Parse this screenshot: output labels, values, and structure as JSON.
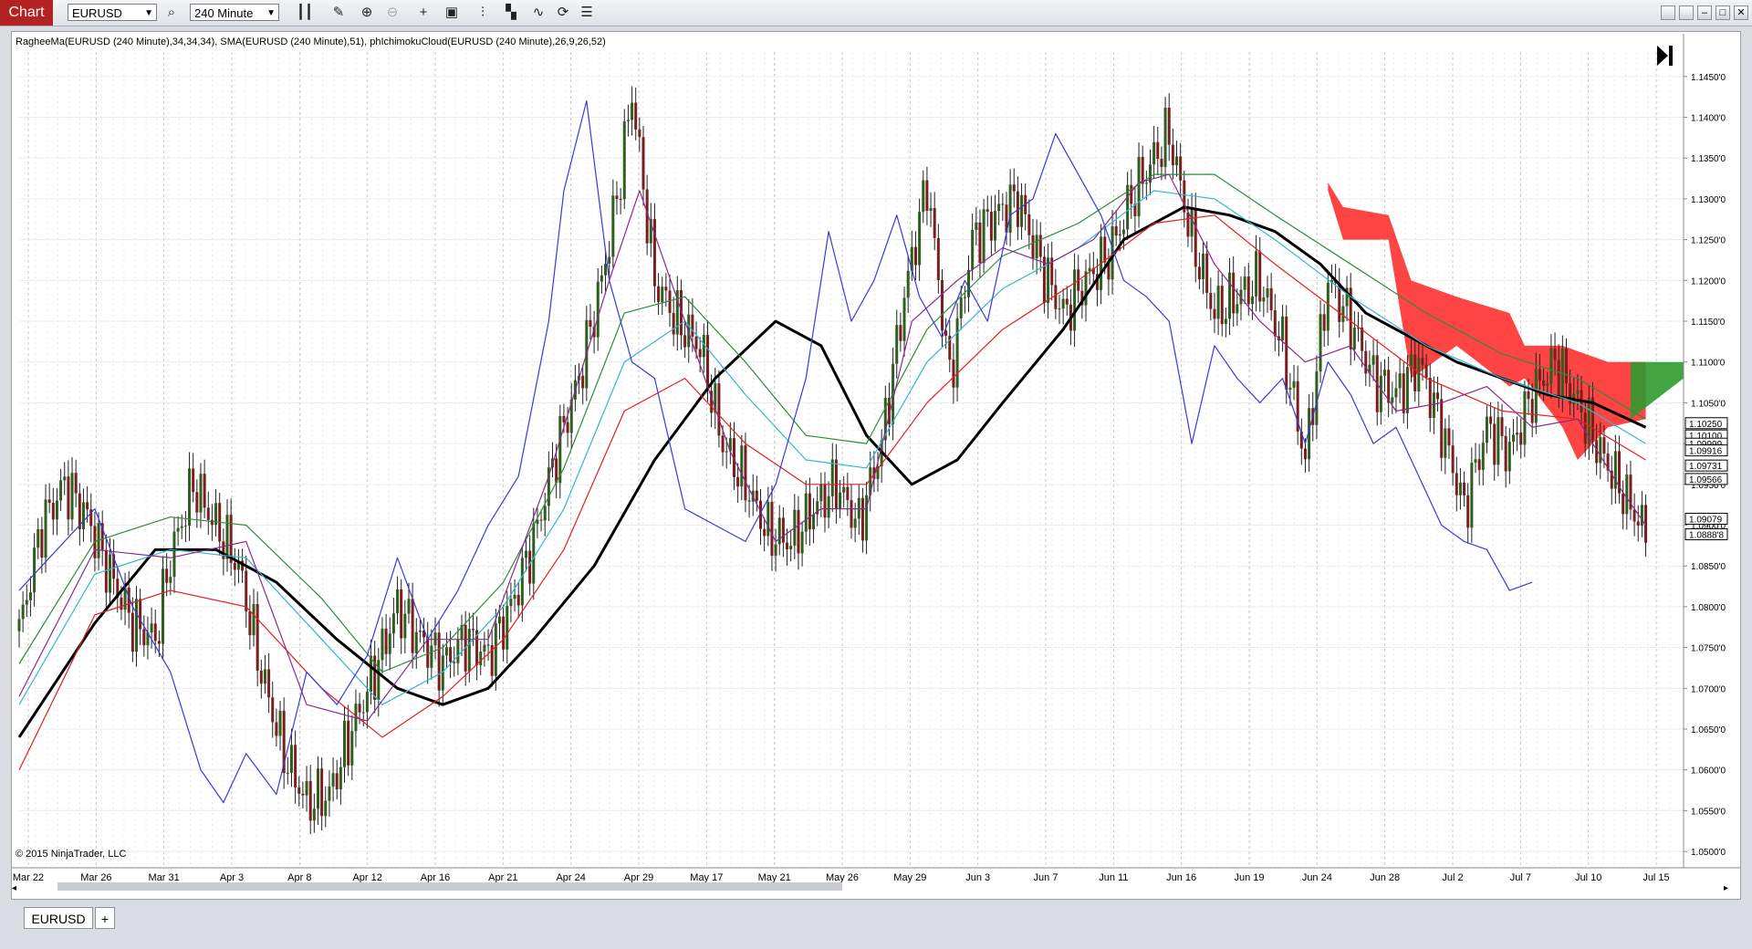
{
  "app": {
    "chart_tab": "Chart"
  },
  "toolbar": {
    "instrument": "EURUSD",
    "interval": "240 Minute",
    "icons": [
      "search-icon",
      "bar-type-icon",
      "draw-pencil-icon",
      "zoom-in-icon",
      "zoom-out-icon",
      "crosshair-icon",
      "data-box-icon",
      "indicators-icon",
      "strategies-icon",
      "chart-style-icon",
      "refresh-icon",
      "properties-icon"
    ]
  },
  "window": {
    "buttons": [
      "restore-icon",
      "tile-icon",
      "minimize-icon",
      "maximize-icon",
      "close-icon"
    ]
  },
  "chart": {
    "indicator_label": "RagheeMa(EURUSD (240 Minute),34,34,34), SMA(EURUSD (240 Minute),51), phIchimokuCloud(EURUSD (240 Minute),26,9,26,52)",
    "copyright": "© 2015 NinjaTrader, LLC",
    "colors": {
      "up_candle": "#2e5f1f",
      "down_candle": "#7a1f1f",
      "sma": "#000000",
      "ragheema_lower": "#e02020",
      "ragheema_mid": "#30b8d0",
      "ragheema_upper": "#2e8b3e",
      "ichimoku_line": "#3a3ad8",
      "ichimoku_purple": "#8b2a8b",
      "cloud_bear": "#ff3030",
      "cloud_bull": "#2e9b2e"
    }
  },
  "chart_data": {
    "type": "candlestick",
    "instrument": "EURUSD",
    "interval": "240 Minute",
    "x_labels": [
      "Mar 22",
      "Mar 26",
      "Mar 31",
      "Apr 3",
      "Apr 8",
      "Apr 12",
      "Apr 16",
      "Apr 21",
      "Apr 24",
      "Apr 29",
      "May 17",
      "May 21",
      "May 26",
      "May 29",
      "Jun 3",
      "Jun 7",
      "Jun 11",
      "Jun 16",
      "Jun 19",
      "Jun 24",
      "Jun 28",
      "Jul 2",
      "Jul 7",
      "Jul 10",
      "Jul 15"
    ],
    "y_ticks": [
      "1.0500'0",
      "1.0550'0",
      "1.0600'0",
      "1.0650'0",
      "1.0700'0",
      "1.0750'0",
      "1.0800'0",
      "1.0850'0",
      "1.0900'0",
      "1.0950'0",
      "1.1000'0",
      "1.1050'0",
      "1.1100'0",
      "1.1150'0",
      "1.1200'0",
      "1.1250'0",
      "1.1300'0",
      "1.1350'0",
      "1.1400'0",
      "1.1450'0"
    ],
    "ylim": [
      1.048,
      1.148
    ],
    "price_markers": [
      "1.10250",
      "1.10100",
      "1.09999",
      "1.09916",
      "1.09731",
      "1.09566",
      "1.09079",
      "1.0888'8"
    ],
    "close_path": [
      [
        0,
        1.077
      ],
      [
        3,
        1.09
      ],
      [
        6,
        1.095
      ],
      [
        9,
        1.091
      ],
      [
        12,
        1.084
      ],
      [
        15,
        1.078
      ],
      [
        18,
        1.076
      ],
      [
        20,
        1.086
      ],
      [
        23,
        1.095
      ],
      [
        26,
        1.09
      ],
      [
        29,
        1.085
      ],
      [
        32,
        1.072
      ],
      [
        35,
        1.062
      ],
      [
        38,
        1.056
      ],
      [
        41,
        1.057
      ],
      [
        44,
        1.065
      ],
      [
        47,
        1.072
      ],
      [
        50,
        1.08
      ],
      [
        53,
        1.076
      ],
      [
        56,
        1.073
      ],
      [
        59,
        1.076
      ],
      [
        62,
        1.074
      ],
      [
        65,
        1.08
      ],
      [
        68,
        1.088
      ],
      [
        71,
        1.099
      ],
      [
        74,
        1.108
      ],
      [
        77,
        1.12
      ],
      [
        79,
        1.13
      ],
      [
        81,
        1.143
      ],
      [
        84,
        1.12
      ],
      [
        87,
        1.115
      ],
      [
        90,
        1.112
      ],
      [
        93,
        1.1
      ],
      [
        96,
        1.095
      ],
      [
        99,
        1.089
      ],
      [
        102,
        1.088
      ],
      [
        105,
        1.092
      ],
      [
        108,
        1.095
      ],
      [
        111,
        1.09
      ],
      [
        114,
        1.1
      ],
      [
        117,
        1.118
      ],
      [
        120,
        1.132
      ],
      [
        123,
        1.108
      ],
      [
        126,
        1.125
      ],
      [
        129,
        1.128
      ],
      [
        132,
        1.13
      ],
      [
        135,
        1.122
      ],
      [
        138,
        1.116
      ],
      [
        141,
        1.12
      ],
      [
        144,
        1.123
      ],
      [
        147,
        1.13
      ],
      [
        150,
        1.135
      ],
      [
        152,
        1.138
      ],
      [
        155,
        1.125
      ],
      [
        158,
        1.116
      ],
      [
        161,
        1.118
      ],
      [
        164,
        1.12
      ],
      [
        167,
        1.112
      ],
      [
        170,
        1.098
      ],
      [
        173,
        1.12
      ],
      [
        176,
        1.115
      ],
      [
        179,
        1.108
      ],
      [
        182,
        1.106
      ],
      [
        185,
        1.11
      ],
      [
        188,
        1.102
      ],
      [
        191,
        1.092
      ],
      [
        194,
        1.102
      ],
      [
        197,
        1.099
      ],
      [
        200,
        1.106
      ],
      [
        203,
        1.11
      ],
      [
        206,
        1.105
      ],
      [
        209,
        1.099
      ],
      [
        212,
        1.094
      ],
      [
        215,
        1.089
      ]
    ],
    "series": [
      {
        "name": "SMA(EURUSD (240 Minute),51)",
        "color": "#000000",
        "points": [
          [
            0,
            1.064
          ],
          [
            10,
            1.078
          ],
          [
            18,
            1.087
          ],
          [
            26,
            1.087
          ],
          [
            34,
            1.083
          ],
          [
            42,
            1.076
          ],
          [
            50,
            1.07
          ],
          [
            56,
            1.068
          ],
          [
            62,
            1.07
          ],
          [
            68,
            1.076
          ],
          [
            76,
            1.085
          ],
          [
            84,
            1.098
          ],
          [
            92,
            1.108
          ],
          [
            100,
            1.115
          ],
          [
            106,
            1.112
          ],
          [
            112,
            1.101
          ],
          [
            118,
            1.095
          ],
          [
            124,
            1.098
          ],
          [
            130,
            1.105
          ],
          [
            138,
            1.114
          ],
          [
            146,
            1.125
          ],
          [
            154,
            1.129
          ],
          [
            160,
            1.128
          ],
          [
            166,
            1.126
          ],
          [
            172,
            1.122
          ],
          [
            178,
            1.116
          ],
          [
            184,
            1.113
          ],
          [
            190,
            1.11
          ],
          [
            196,
            1.108
          ],
          [
            202,
            1.106
          ],
          [
            208,
            1.105
          ],
          [
            215,
            1.102
          ]
        ]
      },
      {
        "name": "RagheeMa lower",
        "color": "#e02020",
        "points": [
          [
            0,
            1.06
          ],
          [
            10,
            1.079
          ],
          [
            20,
            1.082
          ],
          [
            30,
            1.08
          ],
          [
            40,
            1.07
          ],
          [
            48,
            1.064
          ],
          [
            56,
            1.069
          ],
          [
            64,
            1.076
          ],
          [
            72,
            1.087
          ],
          [
            80,
            1.104
          ],
          [
            88,
            1.108
          ],
          [
            96,
            1.1
          ],
          [
            104,
            1.095
          ],
          [
            112,
            1.095
          ],
          [
            120,
            1.105
          ],
          [
            130,
            1.114
          ],
          [
            140,
            1.12
          ],
          [
            150,
            1.127
          ],
          [
            158,
            1.128
          ],
          [
            166,
            1.122
          ],
          [
            176,
            1.115
          ],
          [
            186,
            1.108
          ],
          [
            196,
            1.104
          ],
          [
            206,
            1.103
          ],
          [
            215,
            1.098
          ]
        ]
      },
      {
        "name": "RagheeMa mid",
        "color": "#30b8d0",
        "points": [
          [
            0,
            1.068
          ],
          [
            10,
            1.084
          ],
          [
            20,
            1.087
          ],
          [
            30,
            1.086
          ],
          [
            40,
            1.076
          ],
          [
            48,
            1.068
          ],
          [
            56,
            1.072
          ],
          [
            64,
            1.08
          ],
          [
            72,
            1.092
          ],
          [
            80,
            1.11
          ],
          [
            88,
            1.115
          ],
          [
            96,
            1.106
          ],
          [
            104,
            1.098
          ],
          [
            112,
            1.097
          ],
          [
            120,
            1.11
          ],
          [
            130,
            1.119
          ],
          [
            140,
            1.124
          ],
          [
            150,
            1.131
          ],
          [
            158,
            1.13
          ],
          [
            166,
            1.125
          ],
          [
            176,
            1.118
          ],
          [
            186,
            1.112
          ],
          [
            196,
            1.108
          ],
          [
            206,
            1.105
          ],
          [
            215,
            1.1
          ]
        ]
      },
      {
        "name": "RagheeMa upper",
        "color": "#2e8b3e",
        "points": [
          [
            0,
            1.073
          ],
          [
            10,
            1.088
          ],
          [
            20,
            1.091
          ],
          [
            30,
            1.09
          ],
          [
            40,
            1.081
          ],
          [
            48,
            1.072
          ],
          [
            56,
            1.075
          ],
          [
            64,
            1.083
          ],
          [
            72,
            1.097
          ],
          [
            80,
            1.116
          ],
          [
            88,
            1.118
          ],
          [
            96,
            1.11
          ],
          [
            104,
            1.101
          ],
          [
            112,
            1.1
          ],
          [
            120,
            1.114
          ],
          [
            130,
            1.123
          ],
          [
            140,
            1.127
          ],
          [
            150,
            1.133
          ],
          [
            158,
            1.133
          ],
          [
            166,
            1.128
          ],
          [
            176,
            1.122
          ],
          [
            186,
            1.116
          ],
          [
            196,
            1.111
          ],
          [
            206,
            1.108
          ],
          [
            215,
            1.103
          ]
        ]
      },
      {
        "name": "Ichimoku lagging",
        "color": "#3a3ad8",
        "points": [
          [
            0,
            1.082
          ],
          [
            5,
            1.087
          ],
          [
            10,
            1.092
          ],
          [
            15,
            1.08
          ],
          [
            20,
            1.072
          ],
          [
            24,
            1.06
          ],
          [
            27,
            1.056
          ],
          [
            30,
            1.062
          ],
          [
            34,
            1.057
          ],
          [
            38,
            1.072
          ],
          [
            42,
            1.068
          ],
          [
            46,
            1.074
          ],
          [
            50,
            1.086
          ],
          [
            54,
            1.076
          ],
          [
            58,
            1.082
          ],
          [
            62,
            1.09
          ],
          [
            66,
            1.096
          ],
          [
            70,
            1.115
          ],
          [
            72,
            1.131
          ],
          [
            75,
            1.142
          ],
          [
            78,
            1.12
          ],
          [
            81,
            1.11
          ],
          [
            84,
            1.108
          ],
          [
            88,
            1.092
          ],
          [
            92,
            1.09
          ],
          [
            96,
            1.088
          ],
          [
            100,
            1.095
          ],
          [
            104,
            1.108
          ],
          [
            107,
            1.126
          ],
          [
            110,
            1.115
          ],
          [
            113,
            1.12
          ],
          [
            116,
            1.128
          ],
          [
            119,
            1.118
          ],
          [
            122,
            1.113
          ],
          [
            125,
            1.12
          ],
          [
            128,
            1.115
          ],
          [
            131,
            1.128
          ],
          [
            134,
            1.13
          ],
          [
            137,
            1.138
          ],
          [
            140,
            1.133
          ],
          [
            143,
            1.128
          ],
          [
            146,
            1.12
          ],
          [
            149,
            1.118
          ],
          [
            152,
            1.115
          ],
          [
            155,
            1.1
          ],
          [
            158,
            1.112
          ],
          [
            161,
            1.108
          ],
          [
            164,
            1.105
          ],
          [
            167,
            1.108
          ],
          [
            170,
            1.1
          ],
          [
            173,
            1.11
          ],
          [
            176,
            1.106
          ],
          [
            179,
            1.1
          ],
          [
            182,
            1.102
          ],
          [
            185,
            1.096
          ],
          [
            188,
            1.09
          ],
          [
            191,
            1.088
          ],
          [
            194,
            1.087
          ],
          [
            197,
            1.082
          ],
          [
            200,
            1.083
          ]
        ]
      },
      {
        "name": "Ichimoku purple",
        "color": "#8b2a8b",
        "points": [
          [
            0,
            1.069
          ],
          [
            10,
            1.087
          ],
          [
            20,
            1.086
          ],
          [
            30,
            1.088
          ],
          [
            38,
            1.068
          ],
          [
            46,
            1.066
          ],
          [
            54,
            1.076
          ],
          [
            62,
            1.076
          ],
          [
            70,
            1.096
          ],
          [
            78,
            1.12
          ],
          [
            82,
            1.131
          ],
          [
            88,
            1.115
          ],
          [
            94,
            1.099
          ],
          [
            100,
            1.088
          ],
          [
            106,
            1.092
          ],
          [
            112,
            1.092
          ],
          [
            118,
            1.115
          ],
          [
            124,
            1.12
          ],
          [
            130,
            1.124
          ],
          [
            136,
            1.122
          ],
          [
            142,
            1.125
          ],
          [
            148,
            1.132
          ],
          [
            152,
            1.133
          ],
          [
            158,
            1.122
          ],
          [
            164,
            1.115
          ],
          [
            170,
            1.11
          ],
          [
            176,
            1.112
          ],
          [
            182,
            1.104
          ],
          [
            188,
            1.105
          ],
          [
            194,
            1.107
          ],
          [
            200,
            1.102
          ],
          [
            206,
            1.103
          ],
          [
            212,
            1.094
          ],
          [
            215,
            1.09
          ]
        ]
      }
    ],
    "cloud": [
      {
        "color": "#ff3030",
        "points": [
          [
            173,
            1.132
          ],
          [
            175,
            1.129
          ],
          [
            181,
            1.128
          ],
          [
            184,
            1.12
          ],
          [
            190,
            1.118
          ],
          [
            197,
            1.116
          ],
          [
            199,
            1.112
          ],
          [
            204,
            1.112
          ],
          [
            210,
            1.11
          ],
          [
            215,
            1.11
          ]
        ],
        "lower": [
          [
            173,
            1.131
          ],
          [
            175,
            1.125
          ],
          [
            181,
            1.125
          ],
          [
            184,
            1.108
          ],
          [
            190,
            1.112
          ],
          [
            197,
            1.107
          ],
          [
            199,
            1.108
          ],
          [
            204,
            1.102
          ],
          [
            206,
            1.098
          ],
          [
            210,
            1.102
          ],
          [
            215,
            1.103
          ]
        ]
      },
      {
        "color": "#2e9b2e",
        "points": [
          [
            213,
            1.11
          ],
          [
            220,
            1.11
          ]
        ],
        "lower": [
          [
            213,
            1.103
          ],
          [
            220,
            1.108
          ]
        ]
      }
    ]
  },
  "bottom": {
    "tabs": [
      "EURUSD"
    ],
    "add_tab": "+"
  }
}
